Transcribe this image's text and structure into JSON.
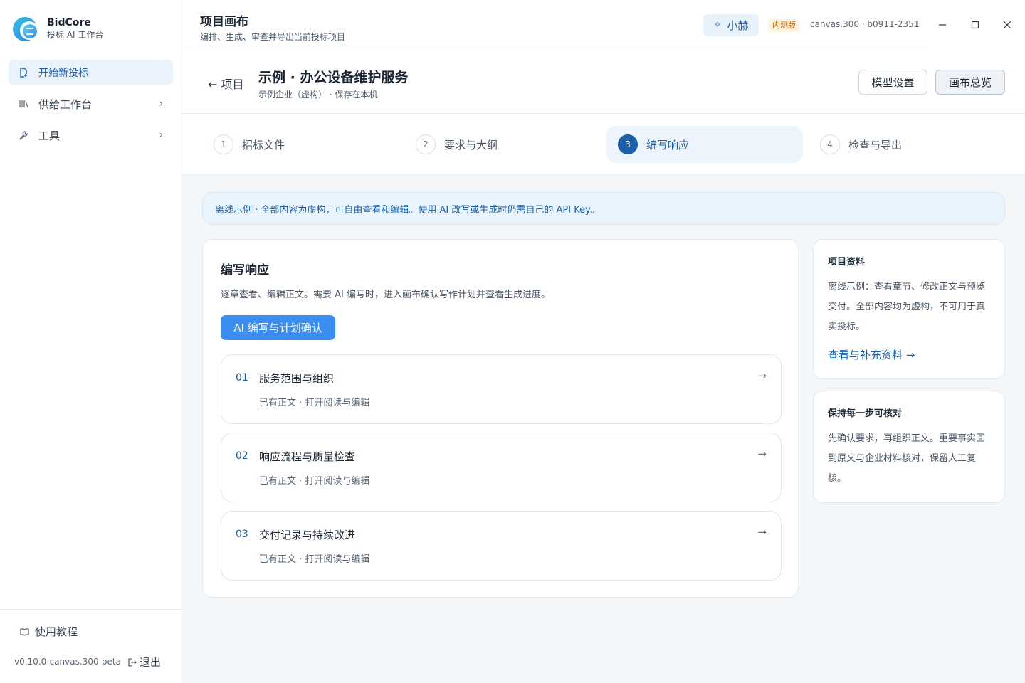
{
  "app": {
    "name": "BidCore",
    "subtitle": "投标 AI 工作台"
  },
  "sidebar": {
    "items": [
      {
        "label": "开始新投标",
        "icon": "new-file-icon",
        "active": true
      },
      {
        "label": "供给工作台",
        "icon": "library-icon",
        "chevron": "›"
      },
      {
        "label": "工具",
        "icon": "wrench-icon",
        "chevron": "›"
      }
    ],
    "tutorial": "使用教程",
    "version": "v0.10.0-canvas.300-beta",
    "logout": "退出"
  },
  "header": {
    "title": "项目画布",
    "subtitle": "编排、生成、审查并导出当前投标项目",
    "assistant": "小赫",
    "badge": "内测版",
    "build": "canvas.300 · b0911-2351"
  },
  "project": {
    "back": "← 项目",
    "title": "示例 · 办公设备维护服务",
    "subtitle": "示例企业（虚构） · 保存在本机",
    "model_settings": "模型设置",
    "canvas_overview": "画布总览"
  },
  "steps": [
    {
      "num": "1",
      "label": "招标文件"
    },
    {
      "num": "2",
      "label": "要求与大纲"
    },
    {
      "num": "3",
      "label": "编写响应",
      "active": true
    },
    {
      "num": "4",
      "label": "检查与导出"
    }
  ],
  "notice": "离线示例 · 全部内容为虚构，可自由查看和编辑。使用 AI 改写或生成时仍需自己的 API Key。",
  "main": {
    "title": "编写响应",
    "subtitle": "逐章查看、编辑正文。需要 AI 编写时，进入画布确认写作计划并查看生成进度。",
    "primary_button": "AI 编写与计划确认",
    "sections": [
      {
        "num": "01",
        "title": "服务范围与组织",
        "desc": "已有正文 · 打开阅读与编辑"
      },
      {
        "num": "02",
        "title": "响应流程与质量检查",
        "desc": "已有正文 · 打开阅读与编辑"
      },
      {
        "num": "03",
        "title": "交付记录与持续改进",
        "desc": "已有正文 · 打开阅读与编辑"
      }
    ]
  },
  "side": {
    "project_info": {
      "title": "项目资料",
      "text": "离线示例：查看章节、修改正文与预览交付。全部内容均为虚构，不可用于真实投标。",
      "link": "查看与补充资料 →"
    },
    "verify": {
      "title": "保持每一步可核对",
      "text": "先确认要求，再组织正文。重要事实回到原文与企业材料核对，保留人工复核。"
    }
  },
  "colors": {
    "accent": "#1b5fa8",
    "primary_button": "#3b8ef0",
    "notice_bg": "#eaf4fc"
  }
}
